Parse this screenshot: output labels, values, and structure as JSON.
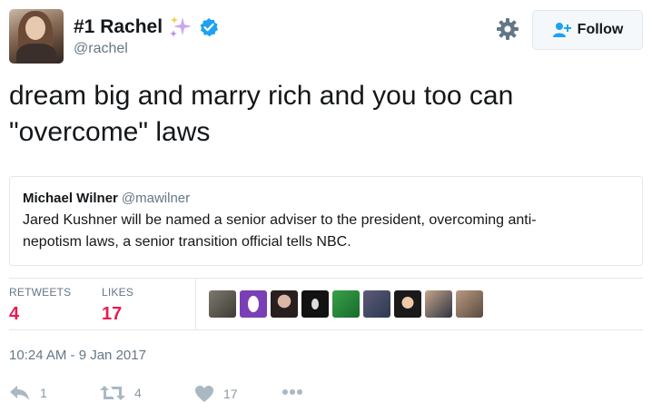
{
  "author": {
    "name": "#1 Rachel",
    "handle": "@rachel"
  },
  "follow_label": "Follow",
  "tweet_text_line1": "dream big and marry rich and you too can",
  "tweet_text_line2": "\"overcome\" laws",
  "quoted": {
    "name": "Michael Wilner",
    "handle": "@mawilner",
    "text_line1": "Jared Kushner will be named a senior adviser to the president, overcoming anti-",
    "text_line2": "nepotism laws, a senior transition official tells NBC."
  },
  "stats": {
    "retweets_label": "RETWEETS",
    "retweets": "4",
    "likes_label": "LIKES",
    "likes": "17"
  },
  "likers_icons": [
    "avatar-1",
    "avatar-2",
    "avatar-3",
    "avatar-4",
    "avatar-5",
    "avatar-6",
    "avatar-7",
    "avatar-8",
    "avatar-9"
  ],
  "timestamp": "10:24 AM - 9 Jan 2017",
  "actions": {
    "reply_count": "1",
    "retweet_count": "4",
    "like_count": "17"
  },
  "colors": {
    "accent": "#1da1f2",
    "like": "#e81c4f",
    "muted": "#657786"
  }
}
